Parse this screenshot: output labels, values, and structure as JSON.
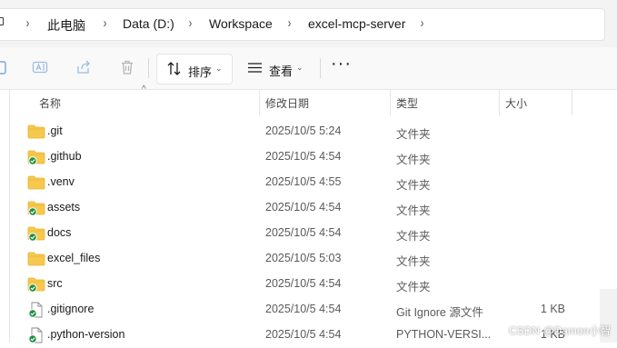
{
  "breadcrumb": {
    "items": [
      "此电脑",
      "Data (D:)",
      "Workspace",
      "excel-mcp-server"
    ],
    "separator": "›"
  },
  "toolbar": {
    "sort_label": "排序",
    "view_label": "查看",
    "more_label": "···"
  },
  "columns": {
    "name": "名称",
    "modified": "修改日期",
    "type": "类型",
    "size": "大小"
  },
  "rows": [
    {
      "name": ".git",
      "modified": "2025/10/5 5:24",
      "type": "文件夹",
      "size": "",
      "icon": "folder-icon",
      "synced": false
    },
    {
      "name": ".github",
      "modified": "2025/10/5 4:54",
      "type": "文件夹",
      "size": "",
      "icon": "folder-icon",
      "synced": true
    },
    {
      "name": ".venv",
      "modified": "2025/10/5 4:55",
      "type": "文件夹",
      "size": "",
      "icon": "folder-icon",
      "synced": false
    },
    {
      "name": "assets",
      "modified": "2025/10/5 4:54",
      "type": "文件夹",
      "size": "",
      "icon": "folder-icon",
      "synced": true
    },
    {
      "name": "docs",
      "modified": "2025/10/5 4:54",
      "type": "文件夹",
      "size": "",
      "icon": "folder-icon",
      "synced": true
    },
    {
      "name": "excel_files",
      "modified": "2025/10/5 5:03",
      "type": "文件夹",
      "size": "",
      "icon": "folder-icon",
      "synced": false
    },
    {
      "name": "src",
      "modified": "2025/10/5 4:54",
      "type": "文件夹",
      "size": "",
      "icon": "folder-icon",
      "synced": true
    },
    {
      "name": ".gitignore",
      "modified": "2025/10/5 4:54",
      "type": "Git Ignore 源文件",
      "size": "1 KB",
      "icon": "file-icon",
      "synced": true
    },
    {
      "name": ".python-version",
      "modified": "2025/10/5 4:54",
      "type": "PYTHON-VERSI...",
      "size": "1 KB",
      "icon": "file-icon",
      "synced": true
    }
  ],
  "watermark": "CSDN @Damon小智",
  "colors": {
    "folder": "#f6c94e",
    "folder_dark": "#e9b435",
    "sync_green": "#1e8e3e",
    "accent": "#0067c0"
  }
}
